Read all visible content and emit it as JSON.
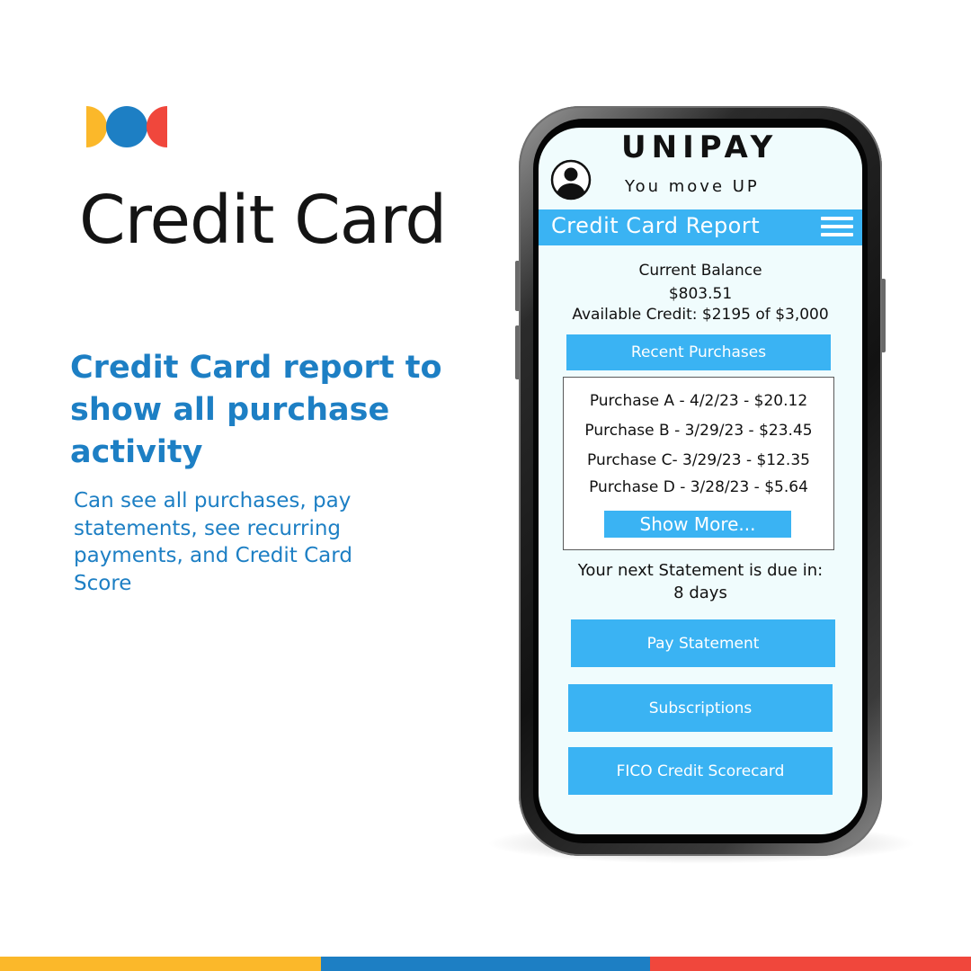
{
  "colors": {
    "brand_blue": "#1d7fc4",
    "brand_yellow": "#fbb82a",
    "brand_red": "#f0473c",
    "app_accent": "#3ab3f3",
    "screen_background": "#f0fcfd",
    "headline_text": "#141414"
  },
  "logo": {
    "icon": "three-circles-logo-icon"
  },
  "marketing": {
    "headline": "Credit Card",
    "subhead": "Credit Card report to show all purchase activity",
    "description": "Can see all purchases, pay statements, see recurring payments, and Credit Card Score"
  },
  "app": {
    "brand": "UNIPAY",
    "tagline": "You move UP",
    "avatar_icon": "user-avatar-icon",
    "report_title": "Credit Card Report",
    "menu_icon": "hamburger-menu-icon",
    "balance_label": "Current Balance",
    "balance_value": "$803.51",
    "available_credit": "Available Credit: $2195 of $3,000",
    "recent_purchases_label": "Recent Purchases",
    "purchases": [
      "Purchase A - 4/2/23 - $20.12",
      "Purchase B - 3/29/23 - $23.45",
      "Purchase C- 3/29/23 - $12.35",
      "Purchase D - 3/28/23 - $5.64"
    ],
    "show_more_label": "Show More...",
    "statement_due_text": "Your next Statement is due in:",
    "statement_due_days": "8 days",
    "pay_statement_label": "Pay Statement",
    "subscriptions_label": "Subscriptions",
    "fico_label": "FICO Credit Scorecard"
  }
}
